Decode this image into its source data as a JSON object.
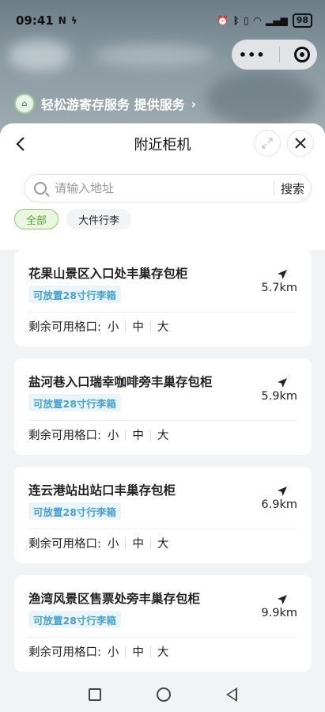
{
  "status_bar": {
    "time": "09:41",
    "battery": "98"
  },
  "promo": {
    "text": "轻松游寄存服务 提供服务",
    "chevron": "›"
  },
  "sheet": {
    "title": "附近柜机",
    "search": {
      "placeholder": "请输入地址",
      "button": "搜索"
    },
    "filters": [
      "全部",
      "大件行李"
    ]
  },
  "lockers": [
    {
      "name": "花果山景区入口处丰巢存包柜",
      "tag": "可放置28寸行李箱",
      "distance": "5.7km",
      "slots_label": "剩余可用格口:",
      "slots": [
        "小",
        "中",
        "大"
      ]
    },
    {
      "name": "盐河巷入口瑞幸咖啡旁丰巢存包柜",
      "tag": "可放置28寸行李箱",
      "distance": "5.9km",
      "slots_label": "剩余可用格口:",
      "slots": [
        "小",
        "中",
        "大"
      ]
    },
    {
      "name": "连云港站出站口丰巢存包柜",
      "tag": "可放置28寸行李箱",
      "distance": "6.9km",
      "slots_label": "剩余可用格口:",
      "slots": [
        "小",
        "中",
        "大"
      ]
    },
    {
      "name": "渔湾风景区售票处旁丰巢存包柜",
      "tag": "可放置28寸行李箱",
      "distance": "9.9km",
      "slots_label": "剩余可用格口:",
      "slots": [
        "小",
        "中",
        "大"
      ]
    }
  ],
  "colors": {
    "accent_green": "#5aa53a",
    "tag_blue": "#4aa0cf"
  }
}
